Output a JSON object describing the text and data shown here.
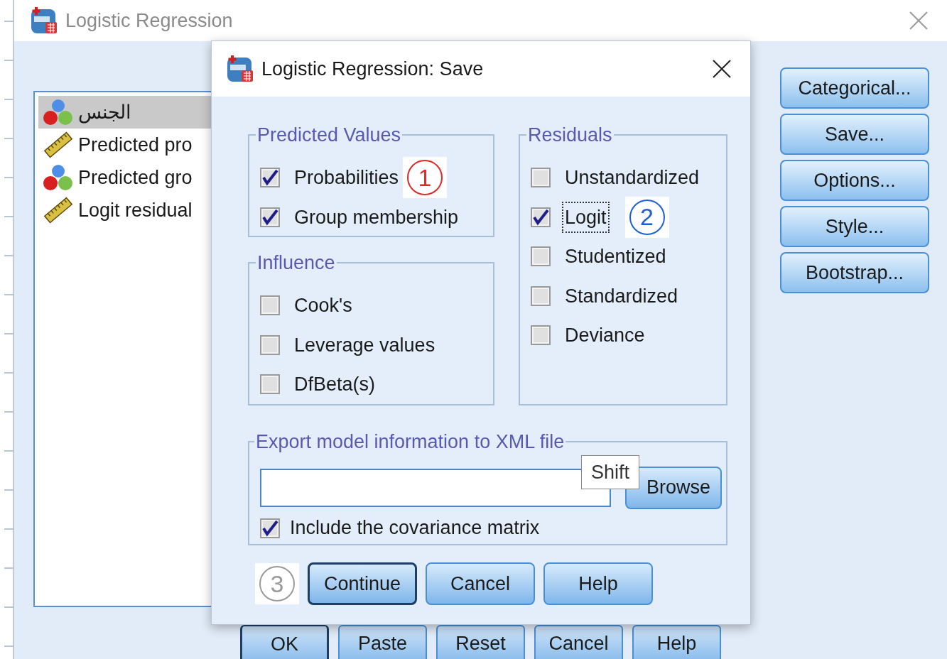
{
  "main_window": {
    "title": "Logistic Regression",
    "variables": [
      {
        "name": "الجنس",
        "kind": "nominal",
        "selected": true
      },
      {
        "name": "Predicted pro",
        "kind": "scale",
        "selected": false
      },
      {
        "name": "Predicted gro",
        "kind": "nominal",
        "selected": false
      },
      {
        "name": "Logit residual",
        "kind": "scale",
        "selected": false
      }
    ],
    "side_buttons": [
      "Categorical...",
      "Save...",
      "Options...",
      "Style...",
      "Bootstrap..."
    ],
    "bottom_buttons": [
      {
        "label": "OK",
        "default": true
      },
      {
        "label": "Paste",
        "default": false
      },
      {
        "label": "Reset",
        "default": false
      },
      {
        "label": "Cancel",
        "default": false
      },
      {
        "label": "Help",
        "default": false
      }
    ]
  },
  "dialog": {
    "title": "Logistic Regression: Save",
    "left_column": [
      {
        "legend": "Predicted Values",
        "items": [
          {
            "label": "Probabilities",
            "checked": true,
            "focused": false,
            "badge": {
              "text": "1",
              "color": "#e02a2a"
            }
          },
          {
            "label": "Group membership",
            "checked": true,
            "focused": false
          }
        ]
      },
      {
        "legend": "Influence",
        "items": [
          {
            "label": "Cook's",
            "checked": false,
            "focused": false
          },
          {
            "label": "Leverage values",
            "checked": false,
            "focused": false
          },
          {
            "label": "DfBeta(s)",
            "checked": false,
            "focused": false
          }
        ]
      }
    ],
    "right_column": [
      {
        "legend": "Residuals",
        "items": [
          {
            "label": "Unstandardized",
            "checked": false,
            "focused": false
          },
          {
            "label": "Logit",
            "checked": true,
            "focused": true,
            "badge": {
              "text": "2",
              "color": "#1f5fd6"
            }
          },
          {
            "label": "Studentized",
            "checked": false,
            "focused": false
          },
          {
            "label": "Standardized",
            "checked": false,
            "focused": false
          },
          {
            "label": "Deviance",
            "checked": false,
            "focused": false
          }
        ]
      }
    ],
    "export": {
      "legend": "Export model information to XML file",
      "browse": "Browse",
      "tooltip": "Shift",
      "option": {
        "label": "Include the covariance matrix",
        "checked": true
      }
    },
    "buttons": [
      {
        "label": "Continue",
        "default": true,
        "badge": {
          "text": "3",
          "color": "#9a9a9a"
        }
      },
      {
        "label": "Cancel",
        "default": false
      },
      {
        "label": "Help",
        "default": false
      }
    ]
  }
}
